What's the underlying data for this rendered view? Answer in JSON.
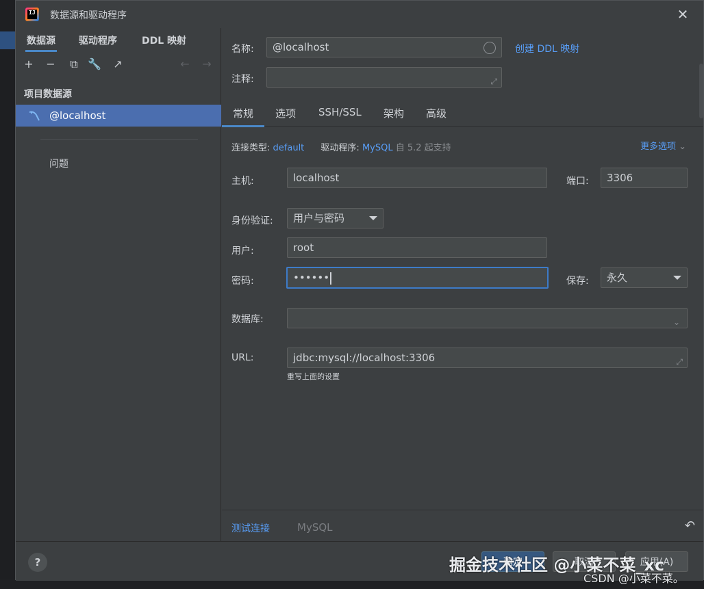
{
  "window": {
    "title": "数据源和驱动程序"
  },
  "left": {
    "tabs": [
      {
        "label": "数据源"
      },
      {
        "label": "驱动程序"
      },
      {
        "label": "DDL 映射"
      }
    ],
    "toolbar": {
      "add": "+",
      "remove": "−",
      "copy": "⧉",
      "settings": "🔧",
      "export": "↗",
      "back": "←",
      "forward": "→"
    },
    "section_label": "项目数据源",
    "datasource": "@localhost",
    "issues_label": "问题"
  },
  "right": {
    "name_label": "名称:",
    "name_value": "@localhost",
    "create_ddl_link": "创建 DDL 映射",
    "comment_label": "注释:",
    "comment_value": "",
    "tabs": [
      {
        "label": "常规"
      },
      {
        "label": "选项"
      },
      {
        "label": "SSH/SSL"
      },
      {
        "label": "架构"
      },
      {
        "label": "高级"
      }
    ],
    "conn_type_label": "连接类型:",
    "conn_type_value": "default",
    "driver_label": "驱动程序:",
    "driver_value": "MySQL",
    "driver_note": "自 5.2 起支持",
    "more_options": "更多选项",
    "host_label": "主机:",
    "host_value": "localhost",
    "port_label": "端口:",
    "port_value": "3306",
    "auth_label": "身份验证:",
    "auth_value": "用户与密码",
    "user_label": "用户:",
    "user_value": "root",
    "password_label": "密码:",
    "password_value": "••••••",
    "save_label": "保存:",
    "save_value": "永久",
    "database_label": "数据库:",
    "database_value": "",
    "url_label": "URL:",
    "url_value": "jdbc:mysql://localhost:3306",
    "url_hint": "重写上面的设置",
    "test_connection": "测试连接",
    "driver_footer": "MySQL"
  },
  "footer": {
    "help": "?",
    "ok": "确定",
    "cancel": "取消",
    "apply": "应用(A)"
  },
  "watermark": {
    "line1": "掘金技术社区 @小菜不菜_xc",
    "line2": "CSDN @小菜不菜。"
  },
  "colors": {
    "accent": "#4a88c7",
    "link": "#589df6",
    "selection": "#4b6eaf",
    "panel": "#3c3f41"
  }
}
